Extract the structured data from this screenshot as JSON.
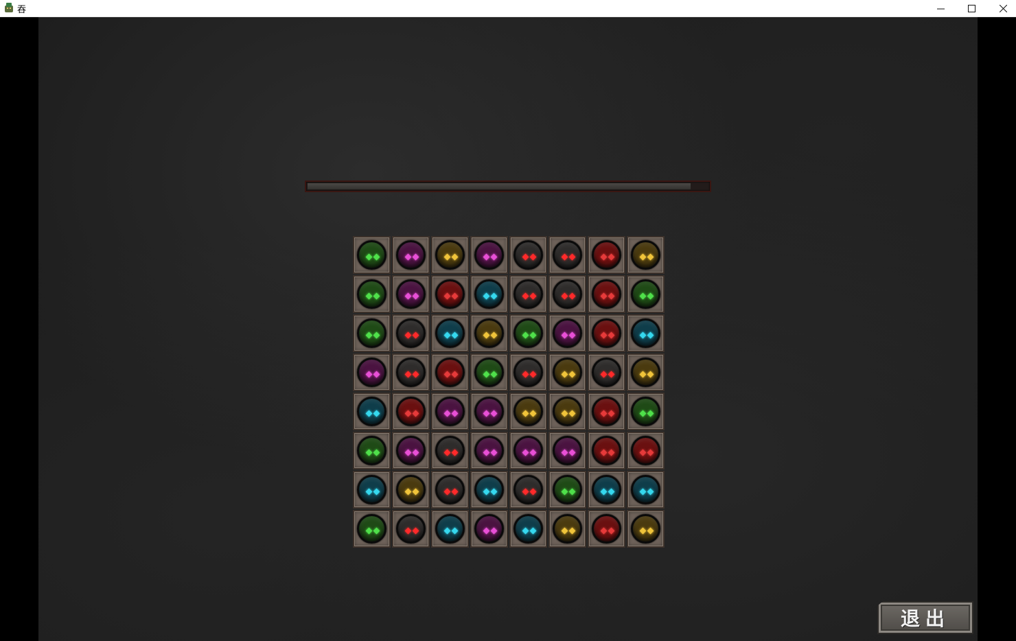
{
  "window": {
    "title": "吞",
    "minimize_symbol": "—",
    "maximize_symbol": "☐",
    "close_symbol": "✕",
    "icon": "app-icon"
  },
  "progress": {
    "value": 0.955
  },
  "board": {
    "rows": 8,
    "cols": 8,
    "grid": [
      [
        "green",
        "purple",
        "yellow",
        "purple",
        "gray",
        "gray",
        "red",
        "yellow"
      ],
      [
        "green",
        "purple",
        "red",
        "cyan",
        "gray",
        "gray",
        "red",
        "green"
      ],
      [
        "green",
        "gray",
        "cyan",
        "yellow",
        "green",
        "purple",
        "red",
        "cyan"
      ],
      [
        "purple",
        "gray",
        "red",
        "green",
        "gray",
        "yellow",
        "gray",
        "yellow"
      ],
      [
        "cyan",
        "red",
        "purple",
        "purple",
        "yellow",
        "yellow",
        "red",
        "green"
      ],
      [
        "green",
        "purple",
        "gray",
        "purple",
        "purple",
        "purple",
        "red",
        "red"
      ],
      [
        "cyan",
        "yellow",
        "gray",
        "cyan",
        "gray",
        "green",
        "cyan",
        "cyan"
      ],
      [
        "green",
        "gray",
        "cyan",
        "purple",
        "cyan",
        "yellow",
        "red",
        "yellow"
      ]
    ]
  },
  "colors": {
    "green": {
      "body": "#1f4a16",
      "eye": "#4fe04a"
    },
    "purple": {
      "body": "#4a1340",
      "eye": "#e84fd6"
    },
    "yellow": {
      "body": "#4a3a0f",
      "eye": "#f0c43a"
    },
    "gray": {
      "body": "#2e2c2b",
      "eye": "#ff2a2a"
    },
    "red": {
      "body": "#6a1010",
      "eye": "#e63a3a"
    },
    "cyan": {
      "body": "#0f3d4a",
      "eye": "#35d8ee"
    }
  },
  "exit_button": {
    "label": "退出"
  }
}
